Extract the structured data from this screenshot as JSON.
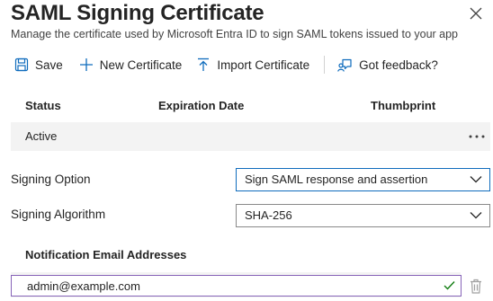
{
  "header": {
    "title": "SAML Signing Certificate",
    "subtitle": "Manage the certificate used by Microsoft Entra ID to sign SAML tokens issued to your app"
  },
  "toolbar": {
    "save_label": "Save",
    "new_certificate_label": "New Certificate",
    "import_certificate_label": "Import Certificate",
    "feedback_label": "Got feedback?"
  },
  "table": {
    "columns": [
      "Status",
      "Expiration Date",
      "Thumbprint"
    ],
    "rows": [
      {
        "status": "Active",
        "expiration_date": "",
        "thumbprint": ""
      }
    ]
  },
  "signing_option": {
    "label": "Signing Option",
    "value": "Sign SAML response and assertion"
  },
  "signing_algorithm": {
    "label": "Signing Algorithm",
    "value": "SHA-256"
  },
  "notification": {
    "label": "Notification Email Addresses",
    "emails": [
      "admin@example.com"
    ]
  },
  "colors": {
    "accent": "#0f6cbd",
    "input_border_focus": "#8764b8",
    "check_green": "#107c10",
    "row_background": "#f3f3f3"
  },
  "icons": {
    "close": "close-icon",
    "save": "save-icon",
    "new": "plus-icon",
    "import": "upload-icon",
    "feedback": "feedback-icon",
    "more": "more-icon",
    "chevron": "chevron-down-icon",
    "valid": "checkmark-icon",
    "delete": "trash-icon"
  }
}
